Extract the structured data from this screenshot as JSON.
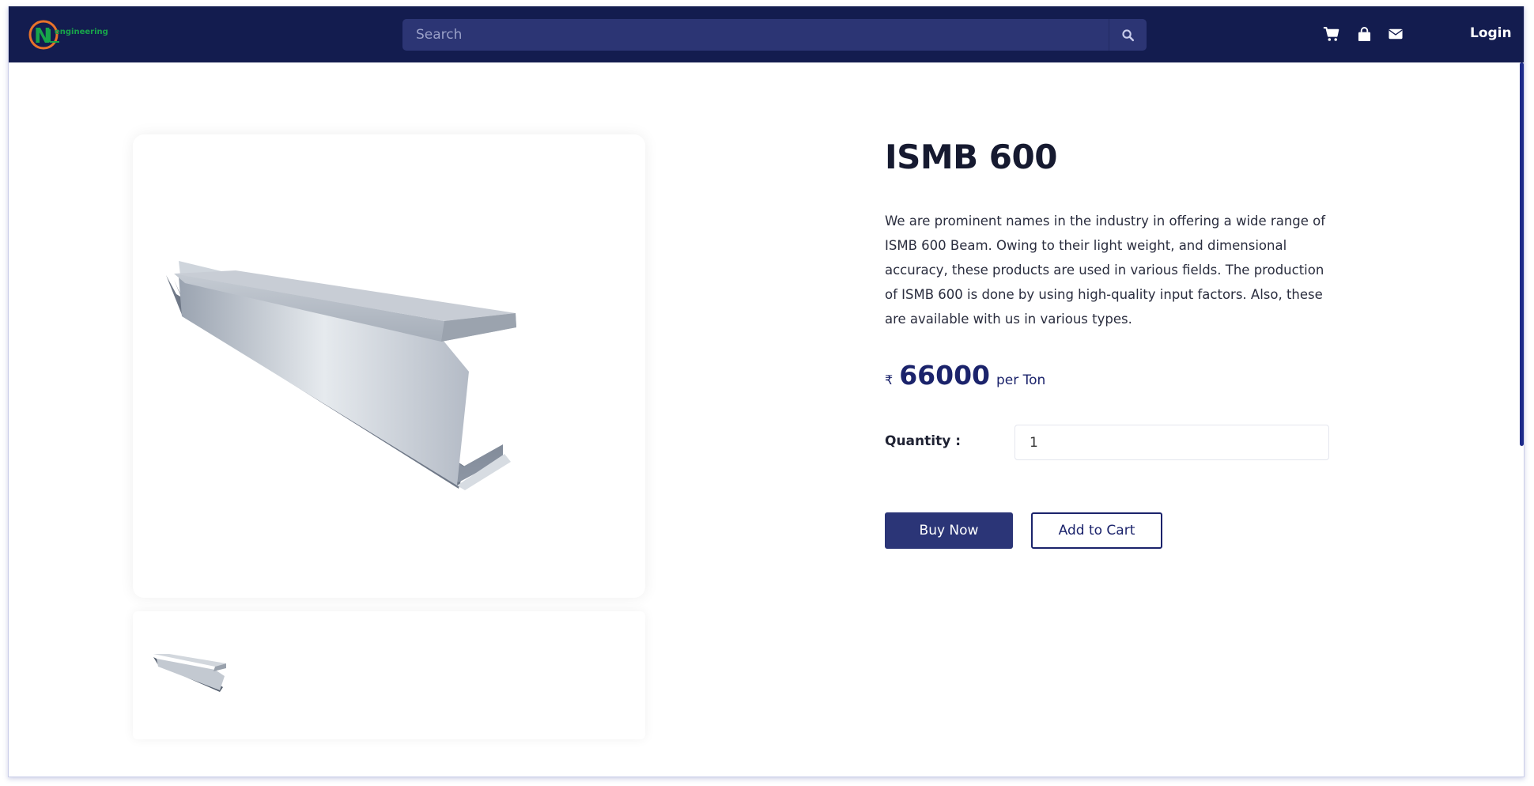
{
  "header": {
    "logo_text": "engineering",
    "logo_initials": "NC",
    "search_placeholder": "Search",
    "icons": [
      "cart-icon",
      "shopping-bag-icon",
      "mail-icon"
    ],
    "login_label": "Login"
  },
  "product": {
    "title": "ISMB 600",
    "description": "We are prominent names in the industry in offering a wide range of ISMB 600 Beam. Owing to their light weight, and dimensional accuracy, these products are used in various fields. The production of ISMB 600 is done by using high-quality input factors. Also, these are available with us in various types.",
    "currency_symbol": "₹",
    "price": "66000",
    "price_unit": "per Ton",
    "quantity_label": "Quantity :",
    "quantity_value": "1",
    "buy_now_label": "Buy Now",
    "add_to_cart_label": "Add to Cart"
  },
  "colors": {
    "navbar": "#131c4f",
    "search_bg": "#2c3574",
    "primary": "#2b3577",
    "accent_text": "#1b236b",
    "logo_orange": "#e8732a",
    "logo_green": "#17a44a"
  }
}
